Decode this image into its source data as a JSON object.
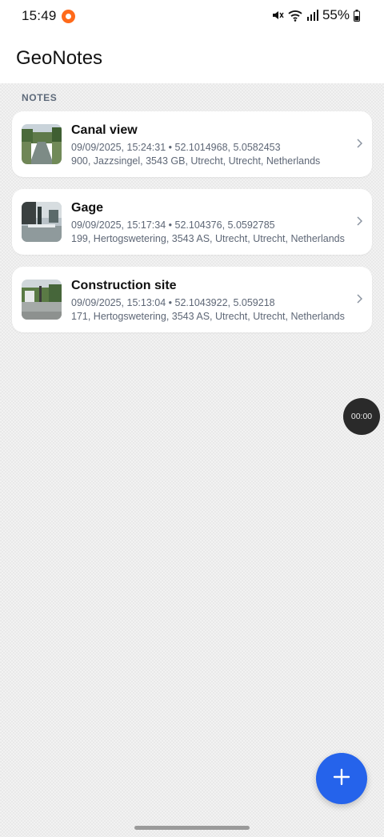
{
  "status_bar": {
    "time": "15:49",
    "battery": "55%",
    "icons": [
      "app-notification-icon",
      "mute-icon",
      "wifi-icon",
      "signal-icon",
      "battery-icon"
    ]
  },
  "app": {
    "title": "GeoNotes"
  },
  "section": {
    "label": "NOTES"
  },
  "notes": [
    {
      "title": "Canal view",
      "meta": "09/09/2025, 15:24:31 • 52.1014968, 5.0582453",
      "address": "900, Jazzsingel, 3543 GB, Utrecht, Utrecht, Netherlands",
      "thumb": "canal-photo"
    },
    {
      "title": "Gage",
      "meta": "09/09/2025, 15:17:34 • 52.104376, 5.0592785",
      "address": "199, Hertogswetering, 3543 AS, Utrecht, Utrecht, Netherlands",
      "thumb": "gage-photo"
    },
    {
      "title": "Construction site",
      "meta": "09/09/2025, 15:13:04 • 52.1043922, 5.059218",
      "address": "171, Hertogswetering, 3543 AS, Utrecht, Utrecht, Netherlands",
      "thumb": "construction-photo"
    }
  ],
  "timer": {
    "label": "00:00"
  },
  "fab": {
    "icon": "plus-icon"
  },
  "colors": {
    "accent": "#2563eb",
    "card": "#ffffff",
    "meta_text": "#5e6776"
  }
}
